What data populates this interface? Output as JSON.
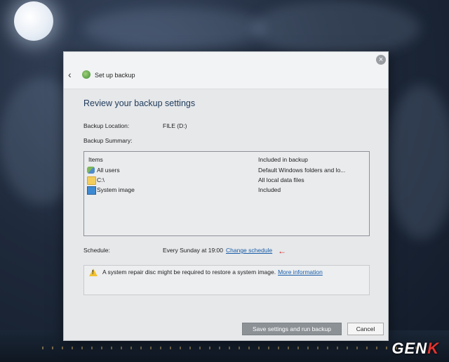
{
  "window": {
    "title": "Set up backup",
    "close_glyph": "×",
    "back_glyph": "‹"
  },
  "heading": "Review your backup settings",
  "backup_location": {
    "label": "Backup Location:",
    "value": "FILE (D:)"
  },
  "backup_summary_label": "Backup Summary:",
  "table": {
    "headers": [
      "Items",
      "Included in backup"
    ],
    "rows": [
      {
        "icon": "users-icon",
        "name": "All users",
        "included": "Default Windows folders and lo..."
      },
      {
        "icon": "folder-icon",
        "name": "C:\\",
        "included": "All local data files"
      },
      {
        "icon": "monitor-icon",
        "name": "System image",
        "included": "Included"
      }
    ]
  },
  "schedule": {
    "label": "Schedule:",
    "value": "Every Sunday at 19:00",
    "change_link": "Change schedule",
    "arrow_glyph": "←"
  },
  "warning": {
    "text": "A system repair disc might be required to restore a system image.",
    "link": "More information"
  },
  "buttons": {
    "primary": "Save settings and run backup",
    "cancel": "Cancel"
  },
  "watermark": {
    "text": "GEN",
    "accent": "K",
    "accent_color": "#e3342f"
  }
}
